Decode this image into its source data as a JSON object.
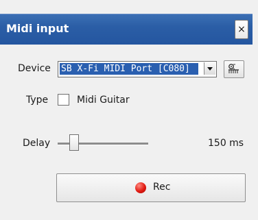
{
  "window": {
    "title": "Midi input",
    "close_label": "×"
  },
  "device": {
    "label": "Device",
    "selected": "SB X-Fi MIDI Port [C080]",
    "settings_icon": "settings-icon"
  },
  "type": {
    "label": "Type",
    "checkbox_label": "Midi Guitar",
    "checked": false
  },
  "delay": {
    "label": "Delay",
    "value_text": "150 ms"
  },
  "record": {
    "label": "Rec",
    "icon": "record-icon",
    "icon_color": "#e11a12"
  },
  "colors": {
    "titlebar": "#2b5ea6",
    "selection": "#2a5fb0",
    "background": "#f0f0f0"
  }
}
